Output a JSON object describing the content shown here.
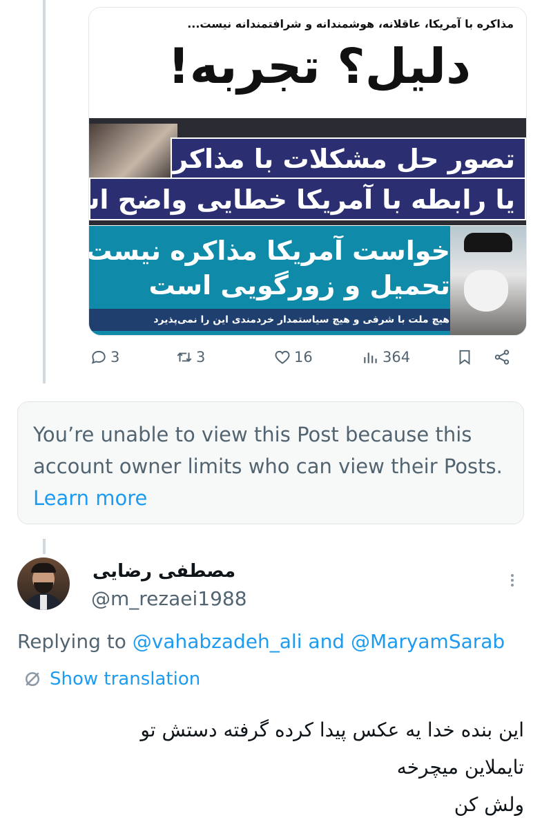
{
  "quoted_image": {
    "subtitle": "مذاکره با آمریکا، عاقلانه، هوشمندانه و شرافتمندانه نیست...",
    "headline": "دلیل؟ تجربه!",
    "band_line1": "تصور حل مشکلات با مذاکره",
    "band_line2": "یا رابطه با آمریکا خطایی واضح است",
    "teal_line1": "خواست آمریکا مذاکره نیست",
    "teal_line2": "تحمیل و زورگویی است",
    "teal_footer": "هیچ ملت با شرفی و هیچ سیاستمدار خردمندی این را نمی‌پذیرد"
  },
  "actions": {
    "replies": "3",
    "reposts": "3",
    "likes": "16",
    "views": "364"
  },
  "notice": {
    "text": "You’re unable to view this Post because this account owner limits who can view their Posts.",
    "link": "Learn more"
  },
  "reply": {
    "name": "مصطفی رضایی",
    "handle": "@m_rezaei1988",
    "replying_prefix": "Replying to",
    "mention1": "@vahabzadeh_ali",
    "and": "and",
    "mention2": "@MaryamSarab",
    "translate_label": "Show translation",
    "text_line1": "این بنده خدا یه عکس پیدا کرده گرفته دستش تو",
    "text_line2": "تایملاین میچرخه",
    "text_line3": "ولش کن"
  },
  "colors": {
    "accent": "#1d9bf0",
    "muted": "#536471",
    "navy": "#2b2f72",
    "teal": "#0f8aa9"
  },
  "icons": [
    "reply-icon",
    "repost-icon",
    "like-icon",
    "views-icon",
    "bookmark-icon",
    "share-icon",
    "translate-icon",
    "more-icon"
  ]
}
